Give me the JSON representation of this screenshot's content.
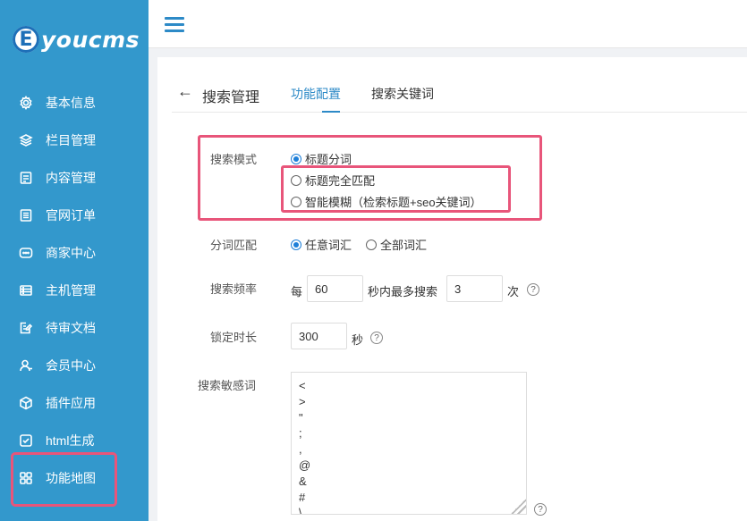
{
  "sidebar": {
    "logo_letter": "E",
    "logo_text": "youcms",
    "items": [
      {
        "label": "基本信息",
        "icon": "gear-icon"
      },
      {
        "label": "栏目管理",
        "icon": "layers-icon"
      },
      {
        "label": "内容管理",
        "icon": "document-icon"
      },
      {
        "label": "官网订单",
        "icon": "list-icon"
      },
      {
        "label": "商家中心",
        "icon": "chat-icon"
      },
      {
        "label": "主机管理",
        "icon": "server-icon"
      },
      {
        "label": "待审文档",
        "icon": "edit-doc-icon"
      },
      {
        "label": "会员中心",
        "icon": "user-icon"
      },
      {
        "label": "插件应用",
        "icon": "cube-icon"
      },
      {
        "label": "html生成",
        "icon": "check-square-icon"
      },
      {
        "label": "功能地图",
        "icon": "grid-icon"
      }
    ]
  },
  "header": {
    "back_glyph": "←",
    "title": "搜索管理",
    "tabs": [
      {
        "label": "功能配置",
        "active": true
      },
      {
        "label": "搜索关键词",
        "active": false
      }
    ]
  },
  "form": {
    "search_mode": {
      "label": "搜索模式",
      "options": [
        "标题分词",
        "标题完全匹配",
        "智能模糊（检索标题+seo关键词）"
      ],
      "selected": "标题分词"
    },
    "word_match": {
      "label": "分词匹配",
      "options": [
        "任意词汇",
        "全部词汇"
      ],
      "selected": "任意词汇"
    },
    "frequency": {
      "label": "搜索频率",
      "prefix": "每",
      "seconds": "60",
      "middle": "秒内最多搜索",
      "times": "3",
      "suffix": "次"
    },
    "lock": {
      "label": "锁定时长",
      "value": "300",
      "unit": "秒"
    },
    "sensitive": {
      "label": "搜索敏感词",
      "lines": [
        "<",
        ">",
        "\"",
        ";",
        ",",
        "@",
        "&",
        "#",
        "\\"
      ]
    },
    "help_glyph": "?"
  },
  "colors": {
    "sidebar_bg": "#3398cc",
    "accent": "#2d8ac7",
    "highlight": "#e8557a"
  }
}
